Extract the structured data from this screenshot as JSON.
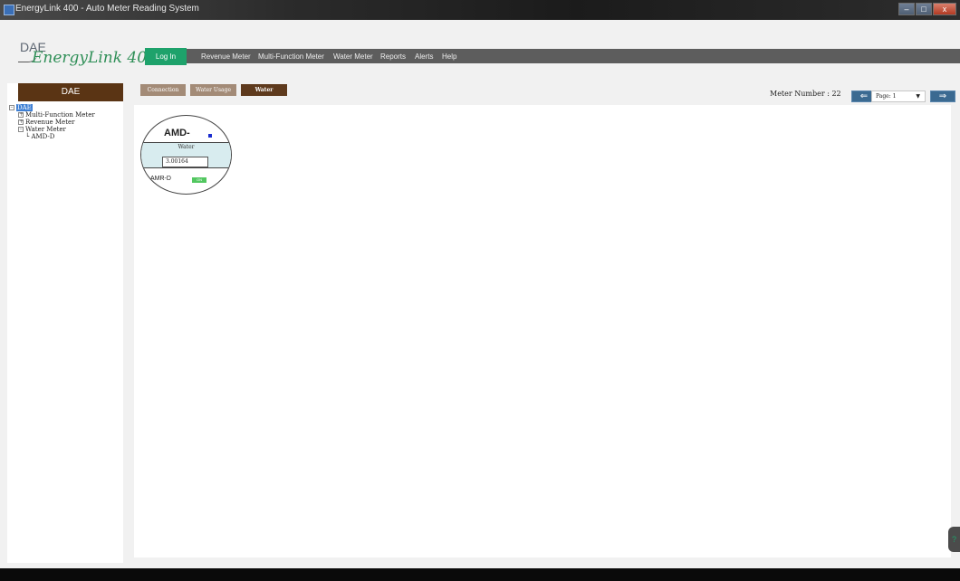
{
  "window": {
    "title": "EnergyLink 400 - Auto Meter Reading System",
    "buttons": {
      "minimize": "–",
      "maximize": "□",
      "close": "x"
    }
  },
  "logo": {
    "brand": "DAE",
    "product": "EnergyLink 400"
  },
  "menu": {
    "login": "Log In",
    "items": [
      "Revenue Meter",
      "Multi-Function Meter",
      "Water Meter",
      "Reports",
      "Alerts",
      "Help"
    ]
  },
  "sidebar": {
    "header": "DAE",
    "tree": {
      "root": "DAE",
      "children": [
        "Multi-Function Meter",
        "Revenue Meter",
        "Water Meter"
      ],
      "grandchild": "AMD-D",
      "expand_symbols": {
        "collapsed": "+",
        "expanded": "–"
      }
    }
  },
  "tabs": [
    {
      "label": "Connection",
      "active": false
    },
    {
      "label": "Water Usage",
      "active": false
    },
    {
      "label": "Water",
      "active": true
    }
  ],
  "controls": {
    "meter_number": "Meter Number : 22",
    "prev_label": "⇐",
    "next_label": "⇒",
    "page_value": "Page: 1",
    "page_caret": "▼"
  },
  "meter": {
    "title": "AMD-",
    "type": "Water",
    "value": "3.00164",
    "id": "AMR-D",
    "status_text": "ON",
    "status_color": "#52c760",
    "indicator_color": "#1a2ccf"
  },
  "side_widget": {
    "icon": "?"
  }
}
